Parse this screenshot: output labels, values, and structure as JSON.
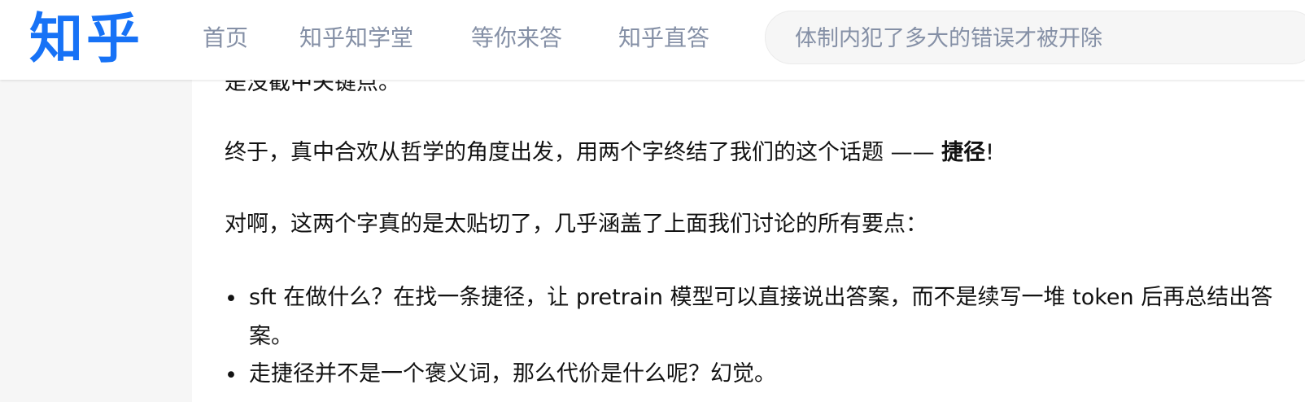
{
  "header": {
    "logo": "知乎",
    "nav": [
      "首页",
      "知乎知学堂",
      "等你来答",
      "知乎直答"
    ],
    "search_placeholder": "体制内犯了多大的错误才被开除"
  },
  "article": {
    "partial_line": "是没截中关键点。",
    "para1_text": "终于，真中合欢从哲学的角度出发，用两个字终结了我们的这个话题 —— ",
    "para1_bold": "捷径",
    "para1_end": "!",
    "para2": "对啊，这两个字真的是太贴切了，几乎涵盖了上面我们讨论的所有要点：",
    "bullet_symbol": "•",
    "bullets": [
      "sft 在做什么？在找一条捷径，让 pretrain 模型可以直接说出答案，而不是续写一堆 token 后再总结出答案。",
      "走捷径并不是一个褒义词，那么代价是什么呢？幻觉。"
    ]
  },
  "colors": {
    "brand": "#1772f6",
    "nav_text": "#8590a6",
    "body_text": "#121212",
    "page_bg": "#f6f6f6",
    "card_bg": "#ffffff"
  }
}
